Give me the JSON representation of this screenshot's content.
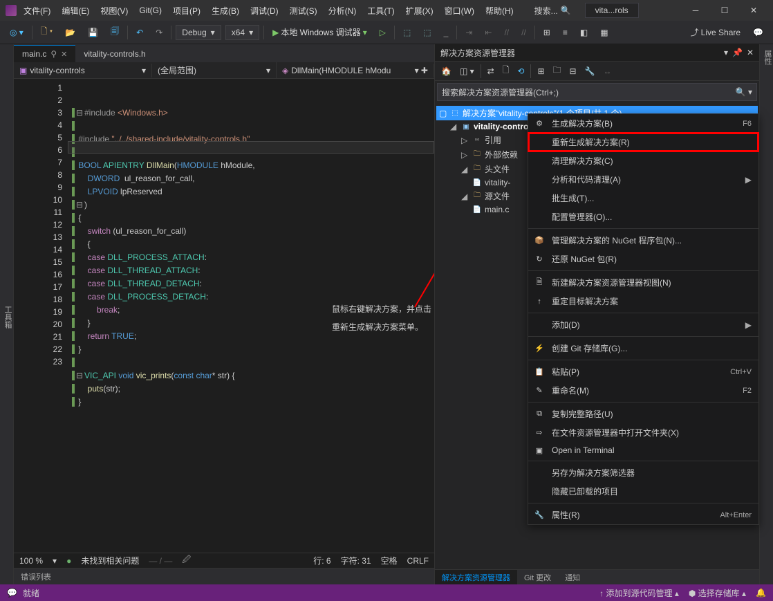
{
  "menubar": {
    "file": "文件(F)",
    "edit": "编辑(E)",
    "view": "视图(V)",
    "git": "Git(G)",
    "project": "项目(P)",
    "build": "生成(B)",
    "debug": "调试(D)",
    "test": "测试(S)",
    "analyze": "分析(N)",
    "tools": "工具(T)",
    "extensions": "扩展(X)",
    "window": "窗口(W)",
    "help": "帮助(H)"
  },
  "title_search": "搜索...",
  "title_tab": "vita...rols",
  "toolbar": {
    "config": "Debug",
    "platform": "x64",
    "debugger": "本地 Windows 调试器",
    "liveshare": "Live Share"
  },
  "left_gutter": "工具箱",
  "right_gutter": "属性",
  "tabs": [
    {
      "name": "main.c",
      "active": true
    },
    {
      "name": "vitality-controls.h",
      "active": false
    }
  ],
  "nav": {
    "project": "vitality-controls",
    "scope": "(全局范围)",
    "function": "DllMain(HMODULE hModu"
  },
  "code_lines": [
    "#include <Windows.h>",
    "",
    "#include \"../../shared-include/vitality-controls.h\"",
    "",
    "BOOL APIENTRY DllMain(HMODULE hModule,",
    "    DWORD  ul_reason_for_call,",
    "    LPVOID lpReserved",
    ")",
    "{",
    "    switch (ul_reason_for_call)",
    "    {",
    "    case DLL_PROCESS_ATTACH:",
    "    case DLL_THREAD_ATTACH:",
    "    case DLL_THREAD_DETACH:",
    "    case DLL_PROCESS_DETACH:",
    "        break;",
    "    }",
    "    return TRUE;",
    "}",
    "",
    "VIC_API void vic_prints(const char* str) {",
    "    puts(str);",
    "}"
  ],
  "annotation": {
    "line1": "鼠标右键解决方案，并点击",
    "line2": "重新生成解决方案菜单。"
  },
  "editor_status": {
    "zoom": "100 %",
    "issues": "未找到相关问题",
    "line": "行: 6",
    "col": "字符: 31",
    "insert": "空格",
    "crlf": "CRLF"
  },
  "solution": {
    "header": "解决方案资源管理器",
    "search_placeholder": "搜索解决方案资源管理器(Ctrl+;)",
    "root": "解决方案\"vitality-controls\"(1 个项目/共 1 个)",
    "project": "vitality-controls",
    "refs": "引用",
    "external": "外部依赖",
    "headers": "头文件",
    "header_file": "vitality-",
    "sources": "源文件",
    "source_file": "main.c"
  },
  "context_menu": [
    {
      "icon": "⚙",
      "label": "生成解决方案(B)",
      "shortcut": "F6"
    },
    {
      "label": "重新生成解决方案(R)",
      "highlighted": true
    },
    {
      "label": "清理解决方案(C)"
    },
    {
      "label": "分析和代码清理(A)",
      "sub": true
    },
    {
      "label": "批生成(T)..."
    },
    {
      "label": "配置管理器(O)..."
    },
    {
      "sep": true
    },
    {
      "icon": "📦",
      "label": "管理解决方案的 NuGet 程序包(N)..."
    },
    {
      "icon": "↻",
      "label": "还原 NuGet 包(R)"
    },
    {
      "sep": true
    },
    {
      "icon": "🗎",
      "label": "新建解决方案资源管理器视图(N)"
    },
    {
      "icon": "↑",
      "label": "重定目标解决方案"
    },
    {
      "sep": true
    },
    {
      "label": "添加(D)",
      "sub": true
    },
    {
      "sep": true
    },
    {
      "icon": "⚡",
      "label": "创建 Git 存储库(G)..."
    },
    {
      "sep": true
    },
    {
      "icon": "📋",
      "label": "粘贴(P)",
      "shortcut": "Ctrl+V",
      "disabled": true
    },
    {
      "icon": "✎",
      "label": "重命名(M)",
      "shortcut": "F2"
    },
    {
      "sep": true
    },
    {
      "icon": "⧉",
      "label": "复制完整路径(U)"
    },
    {
      "icon": "⇨",
      "label": "在文件资源管理器中打开文件夹(X)"
    },
    {
      "icon": "▣",
      "label": "Open in Terminal"
    },
    {
      "sep": true
    },
    {
      "label": "另存为解决方案筛选器"
    },
    {
      "label": "隐藏已卸载的项目"
    },
    {
      "sep": true
    },
    {
      "icon": "🔧",
      "label": "属性(R)",
      "shortcut": "Alt+Enter"
    }
  ],
  "bottom_tabs": {
    "sol": "解决方案资源管理器",
    "git": "Git 更改",
    "notify": "通知"
  },
  "error_list": "错误列表",
  "statusbar": {
    "ready": "就绪",
    "add_source": "添加到源代码管理",
    "select_repo": "选择存储库"
  }
}
